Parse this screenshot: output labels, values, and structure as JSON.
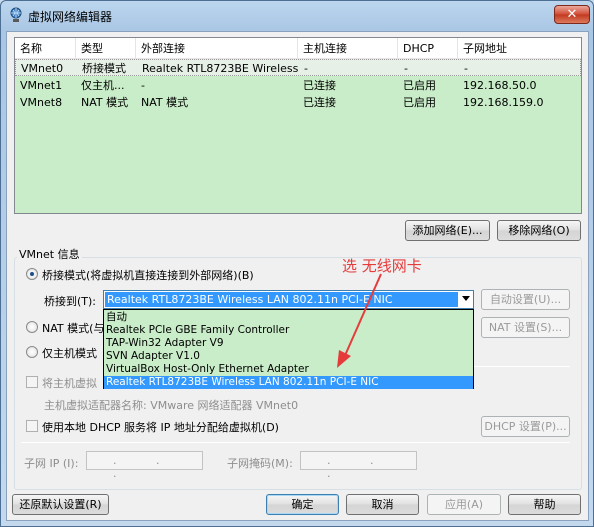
{
  "window": {
    "title": "虚拟网络编辑器",
    "close_glyph": "✕"
  },
  "table": {
    "headers": [
      "名称",
      "类型",
      "外部连接",
      "主机连接",
      "DHCP",
      "子网地址"
    ],
    "rows": [
      [
        "VMnet0",
        "桥接模式",
        "Realtek RTL8723BE Wireless...",
        "-",
        "-",
        "-"
      ],
      [
        "VMnet1",
        "仅主机...",
        "-",
        "已连接",
        "已启用",
        "192.168.50.0"
      ],
      [
        "VMnet8",
        "NAT 模式",
        "NAT 模式",
        "已连接",
        "已启用",
        "192.168.159.0"
      ]
    ]
  },
  "table_buttons": {
    "add": "添加网络(E)...",
    "remove": "移除网络(O)"
  },
  "vmnet_info": {
    "label": "VMnet 信息",
    "bridge_radio": "桥接模式(将虚拟机直接连接到外部网络)(B)",
    "bridge_to_label": "桥接到(T):",
    "bridge_selected": "Realtek RTL8723BE Wireless LAN 802.11n PCI-E NIC",
    "auto_settings": "自动设置(U)...",
    "nat_radio": "NAT 模式(与",
    "nat_settings": "NAT 设置(S)...",
    "hostonly_radio": "仅主机模式",
    "connect_host_checkbox": "将主机虚拟",
    "host_adapter_name": "主机虚拟适配器名称: VMware 网络适配器 VMnet0",
    "dhcp_checkbox": "使用本地 DHCP 服务将 IP 地址分配给虚拟机(D)",
    "dhcp_settings": "DHCP 设置(P)...",
    "subnet_ip_label": "子网 IP (I):",
    "subnet_mask_label": "子网掩码(M):",
    "ip_dots": ". . ."
  },
  "dropdown_options": [
    "自动",
    "Realtek PCIe GBE Family Controller",
    "TAP-Win32 Adapter V9",
    "SVN Adapter V1.0",
    "VirtualBox Host-Only Ethernet Adapter",
    "Realtek RTL8723BE Wireless LAN 802.11n PCI-E NIC"
  ],
  "annotation": "选 无线网卡",
  "footer": {
    "restore": "还原默认设置(R)",
    "ok": "确定",
    "cancel": "取消",
    "apply": "应用(A)",
    "help": "帮助"
  },
  "colors": {
    "table_bg": "#c9ecc9",
    "selection": "#3399ff",
    "annotation": "#e63b3b"
  }
}
